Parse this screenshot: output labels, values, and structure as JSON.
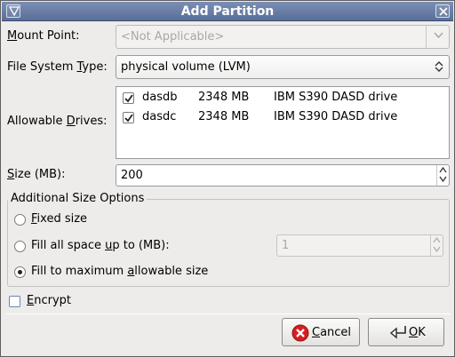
{
  "window": {
    "title": "Add Partition"
  },
  "mount_point": {
    "label_pre": "",
    "label_u": "M",
    "label_post": "ount Point:",
    "value": "<Not Applicable>"
  },
  "fs_type": {
    "label_pre": "File System ",
    "label_u": "T",
    "label_post": "ype:",
    "value": "physical volume (LVM)"
  },
  "drives": {
    "label_pre": "Allowable ",
    "label_u": "D",
    "label_post": "rives:",
    "rows": [
      {
        "checked": true,
        "name": "dasdb",
        "size": "2348 MB",
        "model": "IBM S390 DASD drive"
      },
      {
        "checked": true,
        "name": "dasdc",
        "size": "2348 MB",
        "model": "IBM S390 DASD drive"
      }
    ]
  },
  "size": {
    "label_pre": "",
    "label_u": "S",
    "label_post": "ize (MB):",
    "value": "200"
  },
  "size_options": {
    "title": "Additional Size Options",
    "fixed": {
      "pre": "",
      "u": "F",
      "post": "ixed size",
      "selected": false
    },
    "fill_upto": {
      "pre": "Fill all space ",
      "u": "u",
      "post": "p to (MB):",
      "selected": false,
      "value": "1"
    },
    "fill_max": {
      "pre": "Fill to maximum ",
      "u": "a",
      "post": "llowable size",
      "selected": true
    }
  },
  "encrypt": {
    "pre": "",
    "u": "E",
    "post": "ncrypt",
    "checked": false
  },
  "buttons": {
    "cancel": {
      "pre": "",
      "u": "C",
      "post": "ancel"
    },
    "ok": {
      "pre": "",
      "u": "O",
      "post": "K"
    }
  },
  "colors": {
    "titlebar": "#6a7fa6",
    "window_bg": "#edeceb",
    "cancel_icon": "#d42020"
  }
}
